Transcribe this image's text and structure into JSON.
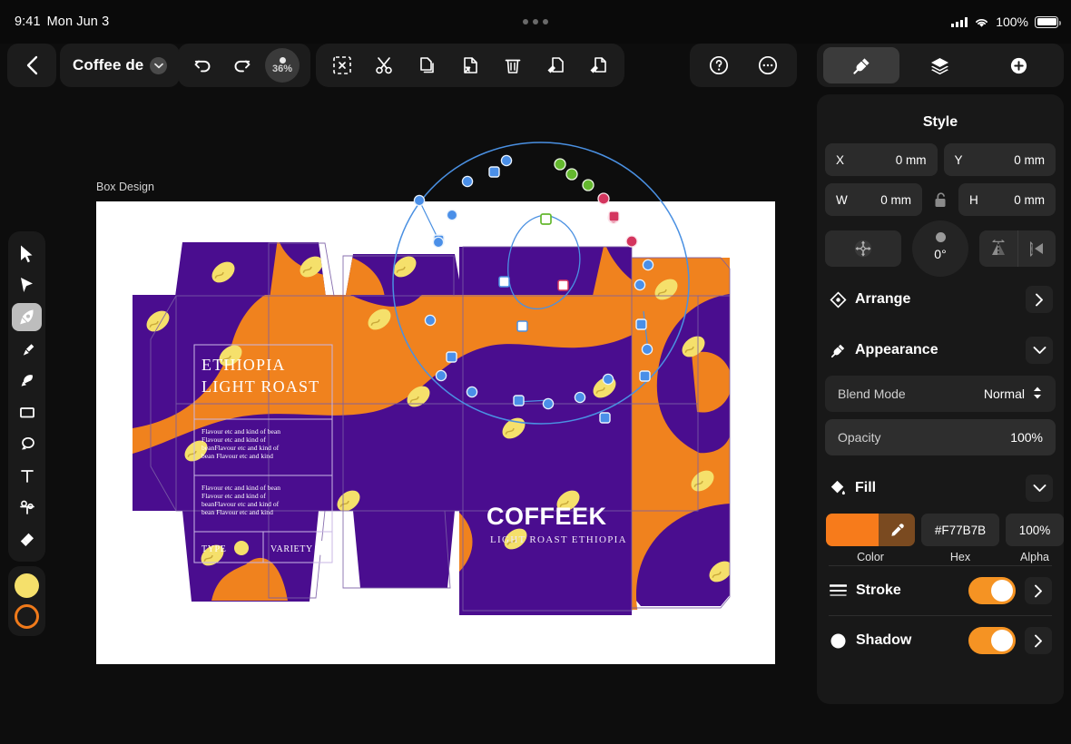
{
  "status_bar": {
    "time": "9:41",
    "date": "Mon Jun 3",
    "battery_percent": "100%",
    "wifi_icon": "wifi-icon",
    "cellular_icon": "cellular-bars-icon",
    "battery_icon": "battery-icon",
    "grabber_icon": "multitask-grabber-icon"
  },
  "toolbar": {
    "back_icon": "chevron-left-icon",
    "document_name": "Coffee de",
    "document_chevron_icon": "chevron-down-icon",
    "undo_icon": "undo-icon",
    "redo_icon": "redo-icon",
    "zoom_level": "36%",
    "ops": [
      {
        "name": "deselect-button",
        "icon": "deselect-frame-icon"
      },
      {
        "name": "cut-button",
        "icon": "scissors-icon"
      },
      {
        "name": "copy-button",
        "icon": "copy-icon"
      },
      {
        "name": "paste-button",
        "icon": "paste-icon"
      },
      {
        "name": "delete-button",
        "icon": "trash-icon"
      },
      {
        "name": "copy-style-button",
        "icon": "copy-style-icon"
      },
      {
        "name": "paste-style-button",
        "icon": "paste-style-icon"
      }
    ],
    "help_icon": "question-circle-icon",
    "more_icon": "ellipsis-circle-icon",
    "panel_tabs": [
      {
        "name": "tab-style",
        "icon": "paintbrush-icon",
        "active": true
      },
      {
        "name": "tab-layers",
        "icon": "layers-icon",
        "active": false
      },
      {
        "name": "tab-add",
        "icon": "plus-circle-icon",
        "active": false
      }
    ]
  },
  "tool_rail": {
    "tools": [
      {
        "name": "tool-select",
        "icon": "cursor-arrow-icon",
        "active": false
      },
      {
        "name": "tool-node",
        "icon": "node-select-arrow-icon",
        "active": false
      },
      {
        "name": "tool-pen",
        "icon": "pen-nib-icon",
        "active": true
      },
      {
        "name": "tool-pencil",
        "icon": "pencil-brush-icon",
        "active": false
      },
      {
        "name": "tool-paint",
        "icon": "paint-brush-icon",
        "active": false
      },
      {
        "name": "tool-shape",
        "icon": "rectangle-icon",
        "active": false
      },
      {
        "name": "tool-lasso",
        "icon": "lasso-shape-icon",
        "active": false
      },
      {
        "name": "tool-text",
        "icon": "text-t-icon",
        "active": false
      },
      {
        "name": "tool-scissors",
        "icon": "node-scissors-icon",
        "active": false
      },
      {
        "name": "tool-eraser",
        "icon": "eraser-icon",
        "active": false
      }
    ],
    "fill_swatch_color": "#F5E06B",
    "stroke_swatch_color": "#F07A1A"
  },
  "canvas": {
    "artboard_label": "Box Design",
    "background": "#FFFFFF",
    "design_colors": {
      "purple": "#4A0D8F",
      "orange": "#F0821E",
      "yellow": "#F5E06B",
      "white": "#FFFFFF"
    },
    "packaging": {
      "heading_line1": "ETHIOPIA",
      "heading_line2": "LIGHT ROAST",
      "body_text_1": "Flavour etc and kind of bean Flavour etc and kind of beanFlavour etc and kind of bean Flavour etc and kind",
      "body_text_2": "Flavour etc and kind of bean Flavour etc and kind of beanFlavour etc and kind of bean Flavour etc and kind",
      "spec_type_label": "TYPE",
      "spec_variety_label": "VARIETY",
      "brand_name": "COFFEEK",
      "brand_sub": "LIGHT ROAST ETHIOPIA"
    },
    "path_overlay": {
      "stroke_color": "#4A90E2",
      "anchor_fill": "#4A8FE8",
      "green_node": "#64B82E",
      "red_node": "#D4355E",
      "white_node": "#FFFFFF"
    }
  },
  "panel": {
    "title": "Style",
    "geometry": {
      "x_label": "X",
      "x_value": "0 mm",
      "y_label": "Y",
      "y_value": "0 mm",
      "w_label": "W",
      "w_value": "0 mm",
      "h_label": "H",
      "h_value": "0 mm",
      "lock_icon": "unlock-icon",
      "move_icon": "move-anchor-icon",
      "rotation_value": "0°",
      "flip_h_icon": "flip-horizontal-icon",
      "flip_v_icon": "flip-vertical-icon"
    },
    "sections": {
      "arrange": {
        "label": "Arrange",
        "icon": "arrange-diamond-icon",
        "chevron": "chevron-right-icon"
      },
      "appearance": {
        "label": "Appearance",
        "icon": "paintbrush-icon",
        "chevron": "chevron-down-icon",
        "blend_mode_label": "Blend Mode",
        "blend_mode_value": "Normal",
        "blend_mode_icon": "up-down-chevrons-icon",
        "opacity_label": "Opacity",
        "opacity_value": "100%"
      },
      "fill": {
        "label": "Fill",
        "icon": "fill-bucket-icon",
        "chevron": "chevron-down-icon",
        "color_caption": "Color",
        "hex_caption": "Hex",
        "alpha_caption": "Alpha",
        "color_value": "#F77B1B",
        "hex_value": "#F77B7B",
        "alpha_value": "100%",
        "eyedropper_icon": "eyedropper-icon"
      },
      "stroke": {
        "label": "Stroke",
        "icon": "stroke-lines-icon",
        "toggle_on": true,
        "chevron": "chevron-right-icon"
      },
      "shadow": {
        "label": "Shadow",
        "icon": "shadow-circle-icon",
        "toggle_on": true,
        "chevron": "chevron-right-icon"
      }
    },
    "accent_color": "#F59323"
  }
}
